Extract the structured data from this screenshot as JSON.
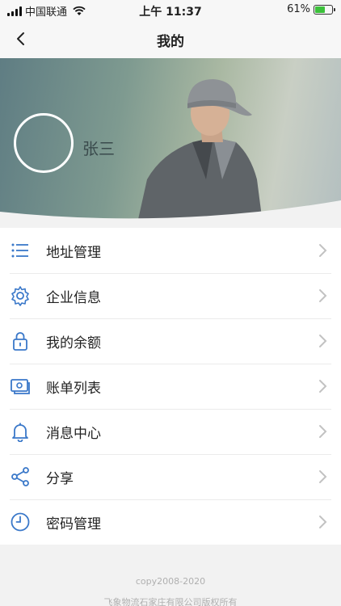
{
  "status_bar": {
    "carrier": "中国联通",
    "time": "上午 11:37",
    "battery_percent": "61%",
    "battery_level": 0.61
  },
  "nav": {
    "title": "我的"
  },
  "profile": {
    "name": "张三"
  },
  "menu": {
    "items": [
      {
        "label": "地址管理",
        "icon": "list-icon"
      },
      {
        "label": "企业信息",
        "icon": "gear-icon"
      },
      {
        "label": "我的余额",
        "icon": "lock-icon"
      },
      {
        "label": "账单列表",
        "icon": "bill-icon"
      },
      {
        "label": "消息中心",
        "icon": "bell-icon"
      },
      {
        "label": "分享",
        "icon": "share-icon"
      },
      {
        "label": "密码管理",
        "icon": "clock-icon"
      }
    ]
  },
  "footer": {
    "copyright": "copy2008-2020",
    "company": "飞象物流石家庄有限公司版权所有"
  },
  "colors": {
    "icon_blue": "#3a78c9",
    "arrow_gray": "#c2c2c2"
  }
}
